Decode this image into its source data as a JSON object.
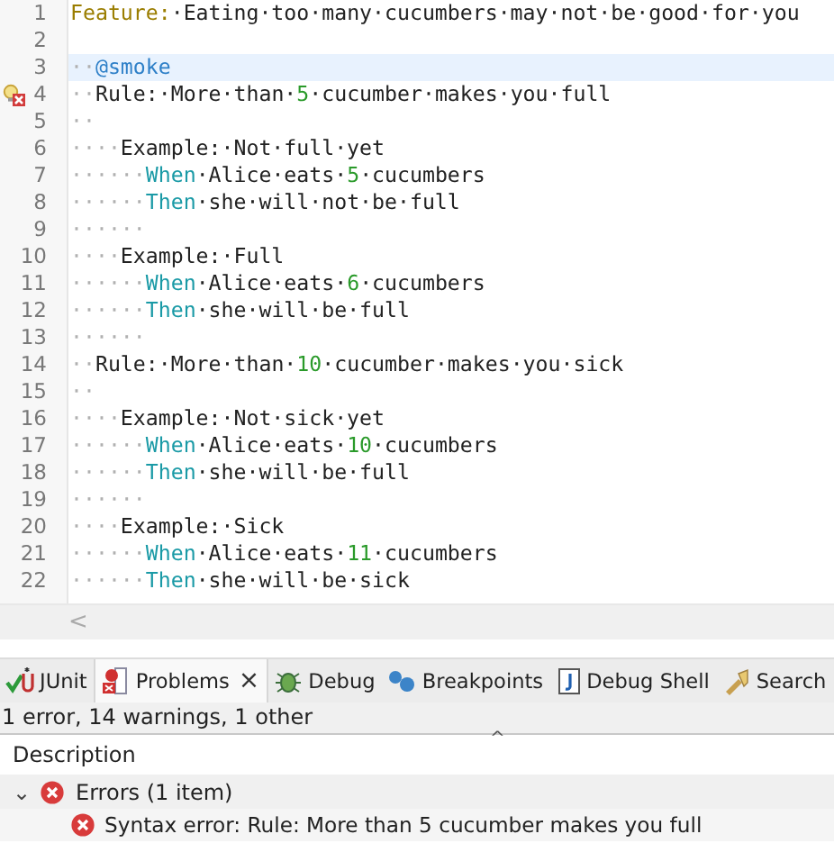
{
  "editor": {
    "lines": [
      {
        "number": "1",
        "current": false,
        "error": false,
        "tokens": [
          {
            "kind": "keyword",
            "text": "Feature:"
          },
          {
            "kind": "text",
            "text": "·Eating·too·many·cucumbers·may·not·be·good·for·you"
          }
        ]
      },
      {
        "number": "2",
        "current": false,
        "error": false
      },
      {
        "number": "3",
        "current": true,
        "error": false,
        "tokens": [
          {
            "kind": "ws",
            "text": "··"
          },
          {
            "kind": "tag",
            "text": "@smoke"
          }
        ]
      },
      {
        "number": "4",
        "current": false,
        "error": true,
        "tokens": [
          {
            "kind": "ws",
            "text": "··"
          },
          {
            "kind": "text",
            "text": "Rule:·More·than·"
          },
          {
            "kind": "number",
            "text": "5"
          },
          {
            "kind": "text",
            "text": "·cucumber·makes·you·full"
          }
        ]
      },
      {
        "number": "5",
        "current": false,
        "error": false,
        "tokens": [
          {
            "kind": "ws",
            "text": "··"
          }
        ]
      },
      {
        "number": "6",
        "current": false,
        "error": false,
        "tokens": [
          {
            "kind": "ws",
            "text": "····"
          },
          {
            "kind": "text",
            "text": "Example:·Not·full·yet"
          }
        ]
      },
      {
        "number": "7",
        "current": false,
        "error": false,
        "tokens": [
          {
            "kind": "ws",
            "text": "······"
          },
          {
            "kind": "step",
            "text": "When"
          },
          {
            "kind": "text",
            "text": "·Alice·eats·"
          },
          {
            "kind": "number",
            "text": "5"
          },
          {
            "kind": "text",
            "text": "·cucumbers"
          }
        ]
      },
      {
        "number": "8",
        "current": false,
        "error": false,
        "tokens": [
          {
            "kind": "ws",
            "text": "······"
          },
          {
            "kind": "step",
            "text": "Then"
          },
          {
            "kind": "text",
            "text": "·she·will·not·be·full"
          }
        ]
      },
      {
        "number": "9",
        "current": false,
        "error": false,
        "tokens": [
          {
            "kind": "ws",
            "text": "······"
          }
        ]
      },
      {
        "number": "10",
        "current": false,
        "error": false,
        "tokens": [
          {
            "kind": "ws",
            "text": "····"
          },
          {
            "kind": "text",
            "text": "Example:·Full"
          }
        ]
      },
      {
        "number": "11",
        "current": false,
        "error": false,
        "tokens": [
          {
            "kind": "ws",
            "text": "······"
          },
          {
            "kind": "step",
            "text": "When"
          },
          {
            "kind": "text",
            "text": "·Alice·eats·"
          },
          {
            "kind": "number",
            "text": "6"
          },
          {
            "kind": "text",
            "text": "·cucumbers"
          }
        ]
      },
      {
        "number": "12",
        "current": false,
        "error": false,
        "tokens": [
          {
            "kind": "ws",
            "text": "······"
          },
          {
            "kind": "step",
            "text": "Then"
          },
          {
            "kind": "text",
            "text": "·she·will·be·full"
          }
        ]
      },
      {
        "number": "13",
        "current": false,
        "error": false,
        "tokens": [
          {
            "kind": "ws",
            "text": "······"
          }
        ]
      },
      {
        "number": "14",
        "current": false,
        "error": false,
        "tokens": [
          {
            "kind": "ws",
            "text": "··"
          },
          {
            "kind": "text",
            "text": "Rule:·More·than·"
          },
          {
            "kind": "number",
            "text": "10"
          },
          {
            "kind": "text",
            "text": "·cucumber·makes·you·sick"
          }
        ]
      },
      {
        "number": "15",
        "current": false,
        "error": false,
        "tokens": [
          {
            "kind": "ws",
            "text": "··"
          }
        ]
      },
      {
        "number": "16",
        "current": false,
        "error": false,
        "tokens": [
          {
            "kind": "ws",
            "text": "····"
          },
          {
            "kind": "text",
            "text": "Example:·Not·sick·yet"
          }
        ]
      },
      {
        "number": "17",
        "current": false,
        "error": false,
        "tokens": [
          {
            "kind": "ws",
            "text": "······"
          },
          {
            "kind": "step",
            "text": "When"
          },
          {
            "kind": "text",
            "text": "·Alice·eats·"
          },
          {
            "kind": "number",
            "text": "10"
          },
          {
            "kind": "text",
            "text": "·cucumbers"
          }
        ]
      },
      {
        "number": "18",
        "current": false,
        "error": false,
        "tokens": [
          {
            "kind": "ws",
            "text": "······"
          },
          {
            "kind": "step",
            "text": "Then"
          },
          {
            "kind": "text",
            "text": "·she·will·be·full"
          }
        ]
      },
      {
        "number": "19",
        "current": false,
        "error": false,
        "tokens": [
          {
            "kind": "ws",
            "text": "······"
          }
        ]
      },
      {
        "number": "20",
        "current": false,
        "error": false,
        "tokens": [
          {
            "kind": "ws",
            "text": "····"
          },
          {
            "kind": "text",
            "text": "Example:·Sick"
          }
        ]
      },
      {
        "number": "21",
        "current": false,
        "error": false,
        "tokens": [
          {
            "kind": "ws",
            "text": "······"
          },
          {
            "kind": "step",
            "text": "When"
          },
          {
            "kind": "text",
            "text": "·Alice·eats·"
          },
          {
            "kind": "number",
            "text": "11"
          },
          {
            "kind": "text",
            "text": "·cucumbers"
          }
        ]
      },
      {
        "number": "22",
        "current": false,
        "error": false,
        "tokens": [
          {
            "kind": "ws",
            "text": "······"
          },
          {
            "kind": "step",
            "text": "Then"
          },
          {
            "kind": "text",
            "text": "·she·will·be·sick"
          }
        ]
      }
    ],
    "scroll_left": "<"
  },
  "tabs": [
    {
      "kind": "junit",
      "label": "JUnit",
      "selected": false
    },
    {
      "kind": "problems",
      "label": "Problems",
      "selected": true,
      "close": "×"
    },
    {
      "kind": "debug",
      "label": "Debug",
      "selected": false
    },
    {
      "kind": "breakpoints",
      "label": "Breakpoints",
      "selected": false
    },
    {
      "kind": "shell",
      "label": "Debug Shell",
      "selected": false
    },
    {
      "kind": "search",
      "label": "Search",
      "selected": false
    }
  ],
  "problems": {
    "summary": "1 error, 14 warnings, 1 other",
    "columns": [
      {
        "label": "Description",
        "sort": "^"
      }
    ],
    "groups": [
      {
        "label": "Errors (1 item)",
        "expanded": true,
        "toggle": "⌄",
        "items": [
          "Syntax error: Rule: More than 5 cucumber makes you full"
        ]
      }
    ]
  }
}
